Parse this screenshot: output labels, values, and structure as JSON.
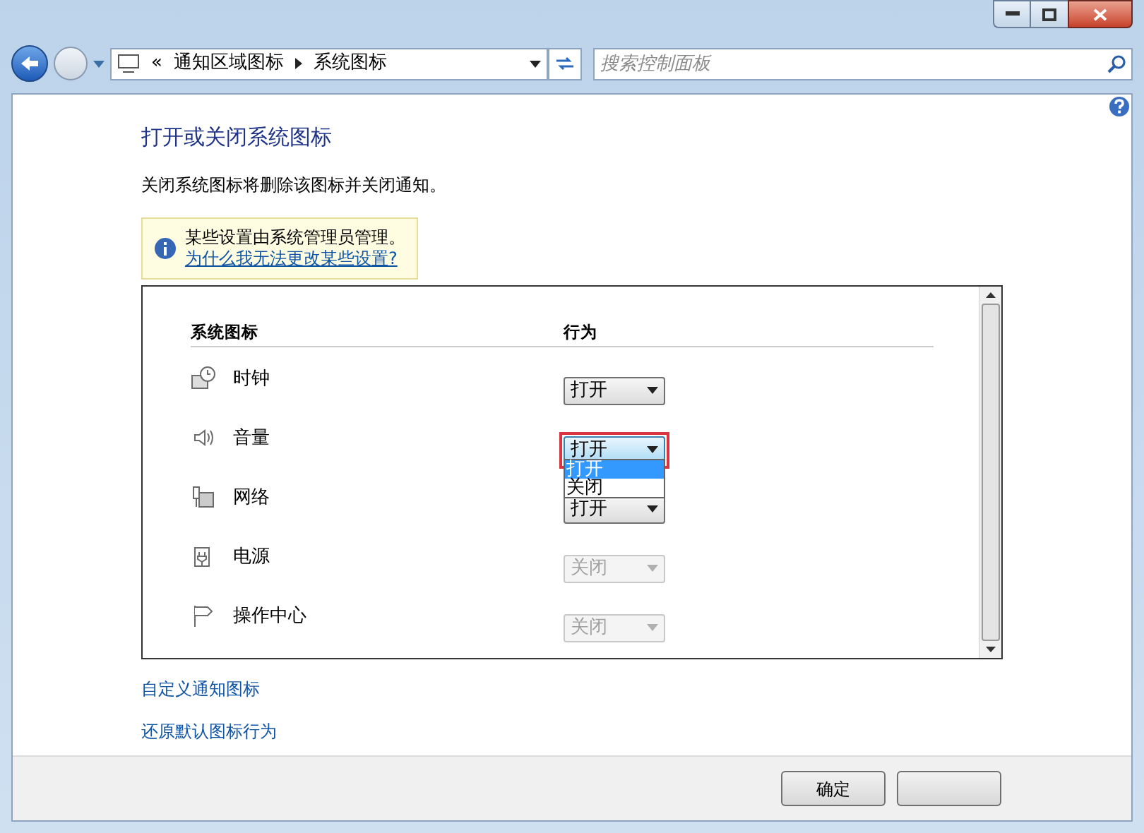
{
  "address": {
    "overflow": "«",
    "breadcrumb": [
      "通知区域图标",
      "系统图标"
    ]
  },
  "search": {
    "placeholder": "搜索控制面板"
  },
  "heading": "打开或关闭系统图标",
  "description": "关闭系统图标将删除该图标并关闭通知。",
  "notice": {
    "text": "某些设置由系统管理员管理。",
    "link": "为什么我无法更改某些设置?"
  },
  "table": {
    "columns": [
      "系统图标",
      "行为"
    ],
    "rows": [
      {
        "kind": "clock",
        "name": "时钟",
        "behavior": "打开",
        "disabled": false,
        "highlighted": false
      },
      {
        "kind": "volume",
        "name": "音量",
        "behavior": "打开",
        "disabled": false,
        "highlighted": true,
        "options": [
          {
            "label": "打开",
            "selected": true
          },
          {
            "label": "关闭",
            "selected": false
          }
        ]
      },
      {
        "kind": "network",
        "name": "网络",
        "behavior": "打开",
        "disabled": false,
        "highlighted": false
      },
      {
        "kind": "power",
        "name": "电源",
        "behavior": "关闭",
        "disabled": true,
        "highlighted": false
      },
      {
        "kind": "flag",
        "name": "操作中心",
        "behavior": "关闭",
        "disabled": true,
        "highlighted": false
      }
    ]
  },
  "links": [
    "自定义通知图标",
    "还原默认图标行为"
  ],
  "buttons": [
    {
      "kind": "text",
      "label": "确定"
    },
    {
      "kind": "blank"
    }
  ]
}
